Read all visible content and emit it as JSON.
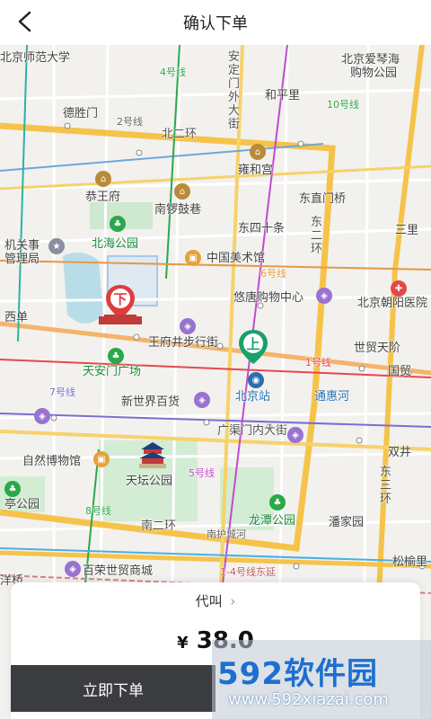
{
  "header": {
    "title": "确认下单"
  },
  "map": {
    "labels": [
      "北京师范大学",
      "北京爱琴海",
      "购物公园",
      "德胜门",
      "2号线",
      "北二环",
      "和平里",
      "安定门外大街",
      "雍和宫",
      "恭王府",
      "南锣鼓巷",
      "东直门桥",
      "东四十条",
      "北海公园",
      "中国美术馆",
      "6号线",
      "悠唐购物中心",
      "北京朝阳医院",
      "王府井步行街",
      "世贸天阶",
      "天安门广场",
      "1号线",
      "北京站",
      "通惠河",
      "新世界百货",
      "广渠门内大街",
      "自然博物馆",
      "天坛公园",
      "龙潭公园",
      "潘家园",
      "南二环",
      "南护城河",
      "松榆里",
      "百荣世贸商城",
      "1-4号线东延",
      "三里",
      "东三环",
      "东二环",
      "双井",
      "国贸",
      "西单",
      "4号线",
      "5号线",
      "7号线",
      "8号线",
      "10号线",
      "机关事",
      "管理局",
      "亭公园",
      "洋桥"
    ],
    "pins": {
      "dropoff": "下",
      "pickup": "上"
    }
  },
  "order": {
    "service_link": "代叫",
    "currency": "¥",
    "price": "38.0",
    "submit_label": "立即下单"
  },
  "watermark": {
    "logo": "592软件园",
    "url": "www.592xiazai.com"
  },
  "colors": {
    "accent_dark": "#3b3c40",
    "pin_dropoff": "#e03c3c",
    "pin_pickup": "#1aa06a",
    "ring_road": "#f6c34a"
  }
}
